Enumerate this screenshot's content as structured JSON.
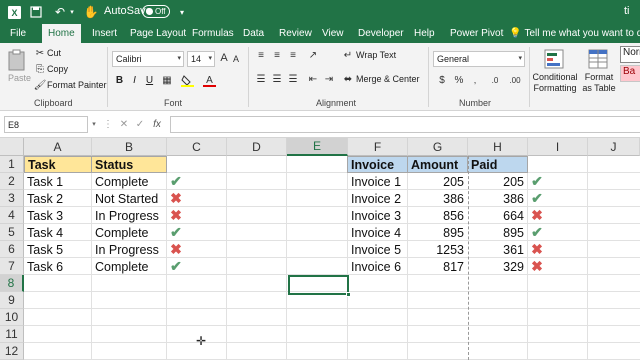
{
  "titlebar": {
    "autosave_label": "AutoSave",
    "autosave_state": "Off",
    "title_fragment": "ti"
  },
  "ribbon_tabs": [
    "File",
    "Home",
    "Insert",
    "Page Layout",
    "Formulas",
    "Data",
    "Review",
    "View",
    "Developer",
    "Help",
    "Power Pivot"
  ],
  "active_tab": "Home",
  "tell_me": "Tell me what you want to do",
  "clipboard": {
    "paste": "Paste",
    "cut": "Cut",
    "copy": "Copy",
    "format_painter": "Format Painter",
    "label": "Clipboard"
  },
  "font": {
    "name": "Calibri",
    "size": "14",
    "bold": "B",
    "italic": "I",
    "underline": "U",
    "label": "Font"
  },
  "alignment": {
    "wrap_text": "Wrap Text",
    "merge_center": "Merge & Center",
    "label": "Alignment"
  },
  "number": {
    "format": "General",
    "label": "Number"
  },
  "styles": {
    "conditional_formatting": "Conditional Formatting",
    "format_as_table": "Format as Table",
    "normal_style": "Norm",
    "bad_style": "Ba"
  },
  "formula_bar": {
    "name_box": "E8",
    "fx": "fx",
    "cancel": "✕",
    "enter": "✓"
  },
  "columns": [
    "A",
    "B",
    "C",
    "D",
    "E",
    "F",
    "G",
    "H",
    "I",
    "J"
  ],
  "rows": [
    "1",
    "2",
    "3",
    "4",
    "5",
    "6",
    "7",
    "8",
    "9",
    "10",
    "11",
    "12"
  ],
  "selected_cell": "E8",
  "task_table": {
    "header": [
      "Task",
      "Status"
    ],
    "rows": [
      {
        "task": "Task 1",
        "status": "Complete",
        "mark": "check"
      },
      {
        "task": "Task 2",
        "status": "Not Started",
        "mark": "cross"
      },
      {
        "task": "Task 3",
        "status": "In Progress",
        "mark": "cross"
      },
      {
        "task": "Task 4",
        "status": "Complete",
        "mark": "check"
      },
      {
        "task": "Task 5",
        "status": "In Progress",
        "mark": "cross"
      },
      {
        "task": "Task 6",
        "status": "Complete",
        "mark": "check"
      }
    ]
  },
  "invoice_table": {
    "header": [
      "Invoice",
      "Amount",
      "Paid"
    ],
    "rows": [
      {
        "invoice": "Invoice 1",
        "amount": "205",
        "paid": "205",
        "mark": "check"
      },
      {
        "invoice": "Invoice 2",
        "amount": "386",
        "paid": "386",
        "mark": "check"
      },
      {
        "invoice": "Invoice 3",
        "amount": "856",
        "paid": "664",
        "mark": "cross"
      },
      {
        "invoice": "Invoice 4",
        "amount": "895",
        "paid": "895",
        "mark": "check"
      },
      {
        "invoice": "Invoice 5",
        "amount": "1253",
        "paid": "361",
        "mark": "cross"
      },
      {
        "invoice": "Invoice 6",
        "amount": "817",
        "paid": "329",
        "mark": "cross"
      }
    ]
  },
  "colors": {
    "excel_green": "#217346",
    "yellow_header": "#ffe699",
    "blue_header": "#bdd7ee",
    "check": "#5a9e6f",
    "cross": "#d9534f"
  }
}
